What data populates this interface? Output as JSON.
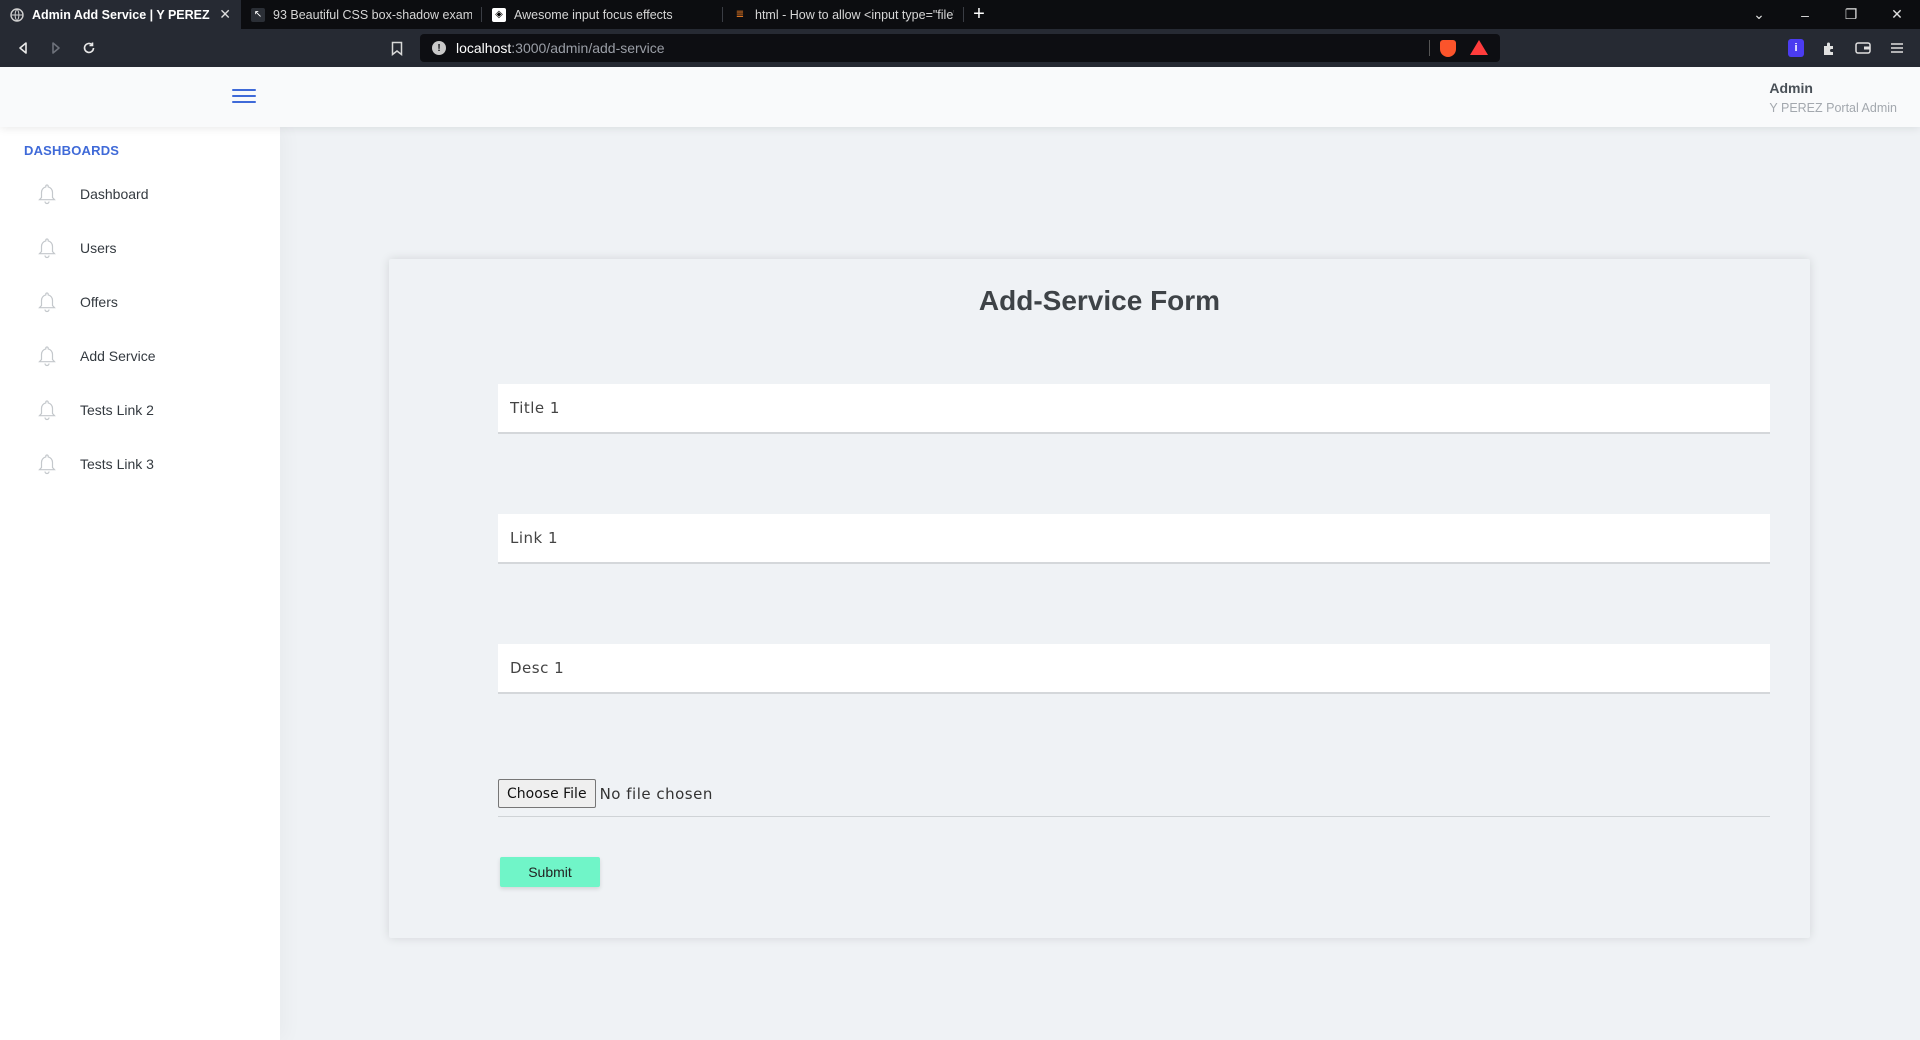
{
  "browser": {
    "tabs": [
      {
        "title": "Admin Add Service | Y PEREZ",
        "active": true
      },
      {
        "title": "93 Beautiful CSS box-shadow examples",
        "active": false
      },
      {
        "title": "Awesome input focus effects",
        "active": false
      },
      {
        "title": "html - How to allow <input type=\"file\"",
        "active": false
      }
    ],
    "url_host": "localhost",
    "url_path": ":3000/admin/add-service"
  },
  "header": {
    "user_name": "Admin",
    "user_role": "Y PEREZ Portal Admin"
  },
  "sidebar": {
    "heading": "DASHBOARDS",
    "items": [
      {
        "label": "Dashboard"
      },
      {
        "label": "Users"
      },
      {
        "label": "Offers"
      },
      {
        "label": "Add Service"
      },
      {
        "label": "Tests Link 2"
      },
      {
        "label": "Tests Link 3"
      }
    ]
  },
  "form": {
    "title": "Add-Service Form",
    "title_placeholder": "Title 1",
    "link_placeholder": "Link 1",
    "desc_placeholder": "Desc 1",
    "file_button": "Choose File",
    "file_status": "No file chosen",
    "submit_label": "Submit"
  },
  "colors": {
    "accent": "#3f6ad8",
    "submit_bg": "#70f5c8",
    "page_bg": "#eff2f5"
  }
}
